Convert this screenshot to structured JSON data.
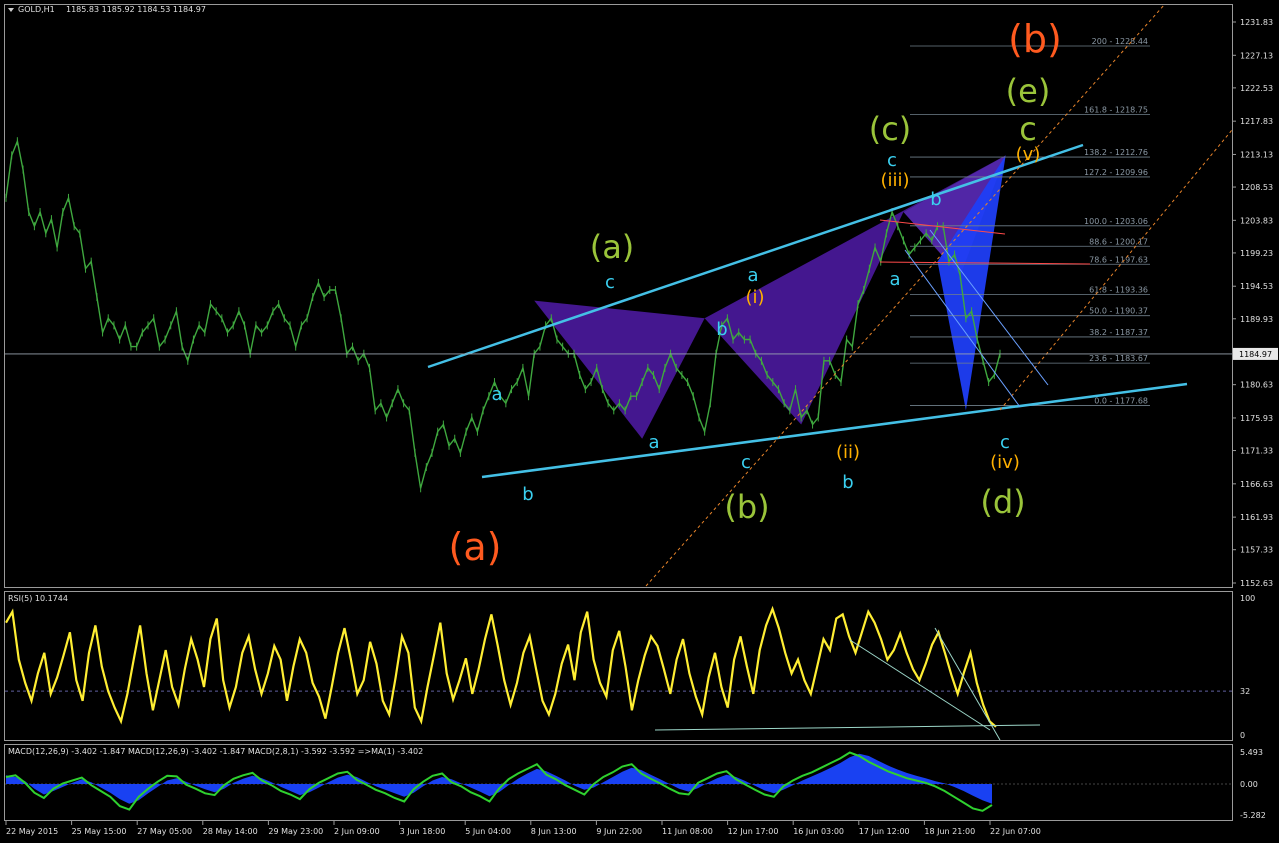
{
  "header": {
    "symbol_label": "GOLD,H1",
    "ohlc_label": "1185.83 1185.92 1184.53 1184.97"
  },
  "colors": {
    "background": "#000000",
    "border": "#9a9a9a",
    "candles": "#3fa83f",
    "channel": "#44c0e6",
    "fib": "#70808c",
    "pattern_fill": "#4b1a9e",
    "rsi": "#ffee33",
    "macd_hist": "#1a44ff",
    "macd_signal": "#2fd12f",
    "wave_orange": "#ff5a1f",
    "wave_olive": "#9ac43a",
    "wave_cyan": "#3ad0f0",
    "wave_amber": "#ffb000"
  },
  "chart_data": [
    {
      "type": "line",
      "panel": "price",
      "title": "GOLD,H1",
      "yticks": [
        "1231.83",
        "1227.13",
        "1222.53",
        "1217.83",
        "1213.13",
        "1208.53",
        "1203.83",
        "1199.23",
        "1194.53",
        "1189.93",
        "1185.23",
        "1180.63",
        "1175.93",
        "1171.33",
        "1166.63",
        "1161.93",
        "1157.33",
        "1152.63"
      ],
      "ylim": [
        1150,
        1235
      ],
      "current_price_label": "1184.97",
      "current_price": 1184.97,
      "series": [
        {
          "values": [
            1207,
            1213,
            1215,
            1211,
            1205,
            1203,
            1205,
            1202,
            1204,
            1200,
            1205,
            1207,
            1203,
            1202,
            1197,
            1198,
            1193,
            1188,
            1190,
            1189,
            1187,
            1189,
            1186,
            1186,
            1188,
            1189,
            1190,
            1186,
            1187,
            1189,
            1191,
            1186,
            1184,
            1187,
            1189,
            1188,
            1192,
            1191,
            1190,
            1188,
            1189,
            1191,
            1189,
            1185,
            1189,
            1188,
            1189,
            1191,
            1192,
            1190,
            1189,
            1186,
            1189,
            1190,
            1193,
            1195,
            1193,
            1194,
            1194,
            1190,
            1185,
            1186,
            1184,
            1185,
            1183,
            1177,
            1178,
            1176,
            1178,
            1180,
            1178,
            1177,
            1171,
            1166,
            1169,
            1171,
            1174,
            1175,
            1172,
            1173,
            1171,
            1174,
            1176,
            1174,
            1177,
            1179,
            1181,
            1179,
            1178,
            1180,
            1181,
            1183,
            1179,
            1185,
            1186,
            1189,
            1190,
            1187,
            1186,
            1185,
            1185,
            1182,
            1180,
            1181,
            1183,
            1180,
            1178,
            1177,
            1178,
            1177,
            1179,
            1179,
            1181,
            1183,
            1182,
            1180,
            1183,
            1185,
            1183,
            1182,
            1181,
            1179,
            1176,
            1174,
            1178,
            1185,
            1189,
            1190,
            1187,
            1188,
            1187,
            1187,
            1185,
            1184,
            1182,
            1181,
            1180,
            1178,
            1177,
            1180,
            1176,
            1177,
            1175,
            1176,
            1184,
            1184,
            1182,
            1181,
            1187,
            1186,
            1192,
            1194,
            1197,
            1200,
            1198,
            1202,
            1205,
            1203,
            1201,
            1199,
            1200,
            1201,
            1202,
            1201,
            1203,
            1203,
            1198,
            1199,
            1196,
            1190,
            1191,
            1187,
            1184,
            1181,
            1182,
            1185
          ]
        }
      ],
      "fib_levels": [
        {
          "label": "200 - 1228.44",
          "value": 1228.44
        },
        {
          "label": "161.8 - 1218.75",
          "value": 1218.75
        },
        {
          "label": "138.2 - 1212.76",
          "value": 1212.76
        },
        {
          "label": "127.2 - 1209.96",
          "value": 1209.96
        },
        {
          "label": "100.0 - 1203.06",
          "value": 1203.06
        },
        {
          "label": "88.6 - 1200.17",
          "value": 1200.17
        },
        {
          "label": "78.6 - 1197.63",
          "value": 1197.63
        },
        {
          "label": "61.8 - 1193.36",
          "value": 1193.36
        },
        {
          "label": "50.0 - 1190.37",
          "value": 1190.37
        },
        {
          "label": "38.2 - 1187.37",
          "value": 1187.37
        },
        {
          "label": "23.6 - 1183.67",
          "value": 1183.67
        },
        {
          "label": "0.0 - 1177.68",
          "value": 1177.68
        }
      ],
      "wave_labels": [
        {
          "text": "(b)",
          "color": "orange"
        },
        {
          "text": "(a)",
          "color": "orange"
        },
        {
          "text": "(e)",
          "color": "olive"
        },
        {
          "text": "(c)",
          "color": "olive"
        },
        {
          "text": "(a)",
          "color": "olive"
        },
        {
          "text": "(b)",
          "color": "olive"
        },
        {
          "text": "(d)",
          "color": "olive"
        },
        {
          "text": "c",
          "color": "olive"
        },
        {
          "text": "a",
          "color": "cyan"
        },
        {
          "text": "b",
          "color": "cyan"
        },
        {
          "text": "c",
          "color": "cyan"
        },
        {
          "text": "a",
          "color": "cyan"
        },
        {
          "text": "c",
          "color": "cyan"
        },
        {
          "text": "a",
          "color": "cyan"
        },
        {
          "text": "b",
          "color": "cyan"
        },
        {
          "text": "b",
          "color": "cyan"
        },
        {
          "text": "c",
          "color": "cyan"
        },
        {
          "text": "a",
          "color": "cyan"
        },
        {
          "text": "b",
          "color": "cyan"
        },
        {
          "text": "c",
          "color": "cyan"
        },
        {
          "text": "(i)",
          "color": "amber"
        },
        {
          "text": "(ii)",
          "color": "amber"
        },
        {
          "text": "(iii)",
          "color": "amber"
        },
        {
          "text": "(iv)",
          "color": "amber"
        },
        {
          "text": "(v)",
          "color": "amber"
        }
      ]
    },
    {
      "type": "line",
      "panel": "rsi",
      "title": "RSI(5) 10.1744",
      "yticks": [
        "100",
        "32",
        "0"
      ],
      "ylim": [
        0,
        100
      ],
      "level": 32,
      "series": [
        {
          "name": "RSI(5)",
          "values": [
            82,
            90,
            55,
            38,
            25,
            45,
            60,
            30,
            42,
            58,
            75,
            40,
            25,
            60,
            80,
            50,
            32,
            20,
            10,
            30,
            55,
            80,
            45,
            18,
            40,
            62,
            35,
            22,
            48,
            70,
            55,
            35,
            70,
            85,
            40,
            20,
            35,
            60,
            72,
            48,
            30,
            45,
            65,
            55,
            25,
            50,
            70,
            60,
            38,
            28,
            12,
            35,
            60,
            78,
            55,
            30,
            40,
            68,
            52,
            25,
            15,
            42,
            72,
            60,
            20,
            10,
            35,
            58,
            82,
            45,
            26,
            40,
            56,
            30,
            48,
            70,
            88,
            65,
            40,
            22,
            38,
            60,
            72,
            48,
            25,
            15,
            30,
            52,
            66,
            40,
            75,
            90,
            55,
            38,
            28,
            62,
            76,
            50,
            18,
            40,
            58,
            72,
            65,
            48,
            30,
            55,
            70,
            45,
            28,
            15,
            42,
            60,
            35,
            20,
            55,
            72,
            50,
            30,
            62,
            80,
            92,
            78,
            60,
            45,
            55,
            40,
            30,
            50,
            70,
            62,
            85,
            88,
            72,
            60,
            75,
            90,
            82,
            70,
            55,
            62,
            74,
            60,
            48,
            40,
            52,
            66,
            75,
            60,
            44,
            30,
            46,
            60,
            38,
            22,
            10,
            6
          ]
        }
      ]
    },
    {
      "type": "bar",
      "panel": "macd",
      "title": "MACD(12,26,9) -3.402 -1.847 MACD(12,26,9) -3.402 -1.847 MACD(2,8,1) -3.592 -3.592 =>MA(1) -3.402",
      "yticks": [
        "5.493",
        "0.00",
        "-5.282"
      ],
      "ylim": [
        -5.282,
        5.493
      ],
      "series": [
        {
          "name": "MACD(12,26,9)",
          "values": [
            1.5,
            1.2,
            0.5,
            -0.8,
            -1.8,
            -1.2,
            -0.5,
            0.2,
            0.8,
            0.3,
            -0.6,
            -1.5,
            -2.6,
            -3.4,
            -2.8,
            -1.6,
            -0.5,
            0.6,
            1.0,
            0.4,
            -0.3,
            -0.9,
            -1.4,
            -0.8,
            0.2,
            0.9,
            1.4,
            1.0,
            0.3,
            -0.5,
            -1.2,
            -1.9,
            -1.4,
            -0.6,
            0.3,
            1.1,
            1.6,
            1.2,
            0.4,
            -0.4,
            -1.0,
            -1.6,
            -2.2,
            -1.5,
            -0.4,
            0.6,
            1.2,
            0.8,
            0.1,
            -0.6,
            -1.3,
            -2.1,
            -1.4,
            -0.2,
            0.9,
            1.8,
            2.6,
            2.2,
            1.4,
            0.6,
            -0.3,
            -1.0,
            -0.6,
            0.3,
            1.2,
            2.1,
            2.8,
            2.4,
            1.6,
            0.8,
            0.0,
            -0.8,
            -1.3,
            -0.7,
            0.2,
            1.0,
            1.6,
            1.2,
            0.5,
            -0.3,
            -1.1,
            -1.6,
            -1.0,
            -0.2,
            0.6,
            1.3,
            2.0,
            2.8,
            3.6,
            4.6,
            5.2,
            4.8,
            4.0,
            3.2,
            2.5,
            1.9,
            1.4,
            1.0,
            0.5,
            0.1,
            -0.5,
            -1.2,
            -2.0,
            -2.8,
            -3.4
          ]
        },
        {
          "name": "MACD(2,8,1)",
          "values": [
            1.2,
            1.5,
            0.2,
            -1.5,
            -2.4,
            -0.8,
            0.1,
            0.6,
            1.1,
            -0.2,
            -1.2,
            -2.2,
            -3.8,
            -4.4,
            -2.2,
            -0.8,
            0.4,
            1.4,
            1.3,
            -0.1,
            -0.8,
            -1.6,
            -1.9,
            -0.2,
            0.9,
            1.5,
            1.9,
            0.6,
            -0.2,
            -1.2,
            -1.8,
            -2.6,
            -0.9,
            0.2,
            1.0,
            1.8,
            2.1,
            0.7,
            -0.1,
            -1.0,
            -1.6,
            -2.4,
            -3.0,
            -0.9,
            0.4,
            1.4,
            1.8,
            0.3,
            -0.4,
            -1.4,
            -2.1,
            -3.0,
            -0.8,
            0.8,
            1.8,
            2.6,
            3.4,
            1.6,
            0.8,
            -0.2,
            -1.0,
            -1.8,
            0.0,
            1.2,
            2.0,
            3.0,
            3.4,
            1.8,
            0.9,
            0.1,
            -0.8,
            -1.6,
            -1.8,
            0.2,
            1.0,
            1.8,
            2.2,
            0.8,
            -0.1,
            -1.0,
            -1.8,
            -2.2,
            -0.4,
            0.6,
            1.4,
            2.0,
            2.8,
            3.6,
            4.4,
            5.4,
            4.8,
            3.8,
            3.0,
            2.2,
            1.6,
            1.0,
            0.6,
            0.2,
            -0.4,
            -1.2,
            -2.2,
            -3.2,
            -4.2,
            -4.6,
            -3.6
          ]
        }
      ]
    }
  ],
  "xaxis_labels": [
    "22 May 2015",
    "25 May 15:00",
    "27 May 05:00",
    "28 May 14:00",
    "29 May 23:00",
    "2 Jun 09:00",
    "3 Jun 18:00",
    "5 Jun 04:00",
    "8 Jun 13:00",
    "9 Jun 22:00",
    "11 Jun 08:00",
    "12 Jun 17:00",
    "16 Jun 03:00",
    "17 Jun 12:00",
    "18 Jun 21:00",
    "22 Jun 07:00"
  ]
}
